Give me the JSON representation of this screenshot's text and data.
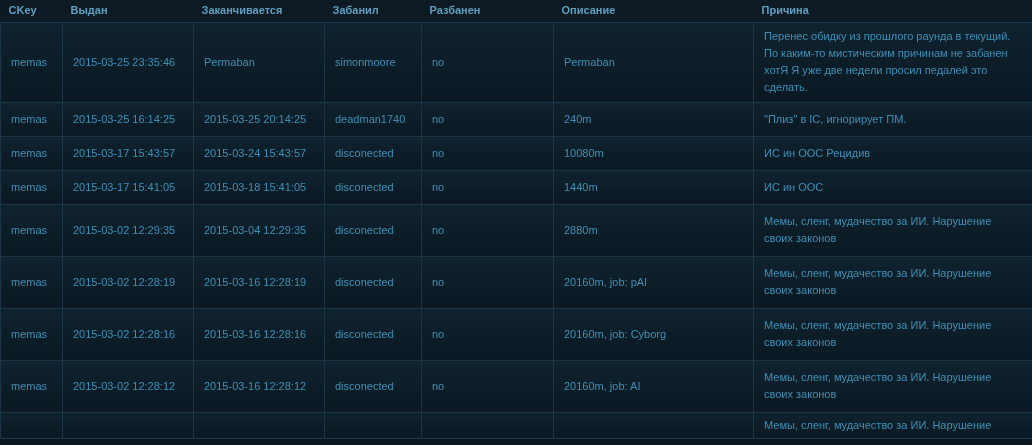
{
  "table": {
    "columns": [
      "CKey",
      "Выдан",
      "Заканчивается",
      "Забанил",
      "Разбанен",
      "Описание",
      "Причина"
    ],
    "rows": [
      {
        "cells": [
          "memas",
          "2015-03-25 23:35:46",
          "Permaban",
          "simonmoore",
          "no",
          "Permaban",
          "Перенес обидку из прошлого раунда в текущий. По каким-то мистическим причинам не забанен хотЯ Я уже две недели просил педалей это сделать."
        ]
      },
      {
        "cells": [
          "memas",
          "2015-03-25 16:14:25",
          "2015-03-25 20:14:25",
          "deadman1740",
          "no",
          "240m",
          "\"Плиз\" в IC, игнорирует ПМ."
        ]
      },
      {
        "cells": [
          "memas",
          "2015-03-17 15:43:57",
          "2015-03-24 15:43:57",
          "disconected",
          "no",
          "10080m",
          "ИС ин ООС Рецидив"
        ]
      },
      {
        "cells": [
          "memas",
          "2015-03-17 15:41:05",
          "2015-03-18 15:41:05",
          "disconected",
          "no",
          "1440m",
          "ИС ин ООС"
        ]
      },
      {
        "cells": [
          "memas",
          "2015-03-02 12:29:35",
          "2015-03-04 12:29:35",
          "disconected",
          "no",
          "2880m",
          "Мемы, сленг, мудачество за ИИ. Нарушение своих законов"
        ]
      },
      {
        "cells": [
          "memas",
          "2015-03-02 12:28:19",
          "2015-03-16 12:28:19",
          "disconected",
          "no",
          "20160m, job: pAI",
          "Мемы, сленг, мудачество за ИИ. Нарушение своих законов"
        ]
      },
      {
        "cells": [
          "memas",
          "2015-03-02 12:28:16",
          "2015-03-16 12:28:16",
          "disconected",
          "no",
          "20160m, job: Cyborg",
          "Мемы, сленг, мудачество за ИИ. Нарушение своих законов"
        ]
      },
      {
        "cells": [
          "memas",
          "2015-03-02 12:28:12",
          "2015-03-16 12:28:12",
          "disconected",
          "no",
          "20160m, job: AI",
          "Мемы, сленг, мудачество за ИИ. Нарушение своих законов"
        ]
      },
      {
        "cells": [
          "",
          "",
          "",
          "",
          "",
          "",
          "Мемы, сленг, мудачество за ИИ. Нарушение"
        ]
      }
    ]
  }
}
